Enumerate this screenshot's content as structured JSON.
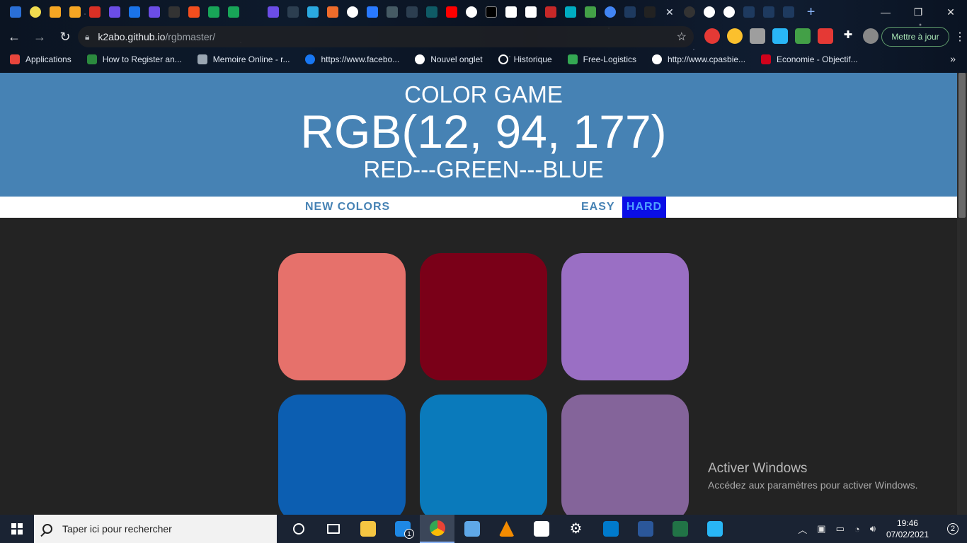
{
  "browser": {
    "url_host": "k2abo.github.io",
    "url_path": "/rgbmaster/",
    "update_button": "Mettre à jour",
    "bookmarks": [
      {
        "label": "Applications",
        "color": "#e8453c"
      },
      {
        "label": "How to Register an...",
        "color": "#2b8a3e"
      },
      {
        "label": "Memoire Online - r...",
        "color": "#9aa6b2"
      },
      {
        "label": "https://www.facebo...",
        "color": "#1877f2"
      },
      {
        "label": "Nouvel onglet",
        "color": "#ffffff"
      },
      {
        "label": "Historique",
        "color": "#ffffff"
      },
      {
        "label": "Free-Logistics",
        "color": "#34a853"
      },
      {
        "label": "http://www.cpasbie...",
        "color": "#ffffff"
      },
      {
        "label": "Economie - Objectif...",
        "color": "#d0021b"
      }
    ]
  },
  "game": {
    "title": "COLOR GAME",
    "rgb_display": "RGB(12, 94, 177)",
    "subtitle": "RED---GREEN---BLUE",
    "new_colors_label": "NEW COLORS",
    "message": "",
    "easy_label": "EASY",
    "hard_label": "HARD",
    "header_color": "#4682b4",
    "squares": [
      "#e6716b",
      "#7a0018",
      "#9a6fc4",
      "#0c5eb1",
      "#0a7abb",
      "#84649a"
    ]
  },
  "watermark": {
    "line1": "Activer Windows",
    "line2": "Accédez aux paramètres pour activer Windows."
  },
  "taskbar": {
    "search_placeholder": "Taper ici pour rechercher",
    "time": "19:46",
    "date": "07/02/2021",
    "notification_count": "2",
    "mail_badge": "1"
  }
}
